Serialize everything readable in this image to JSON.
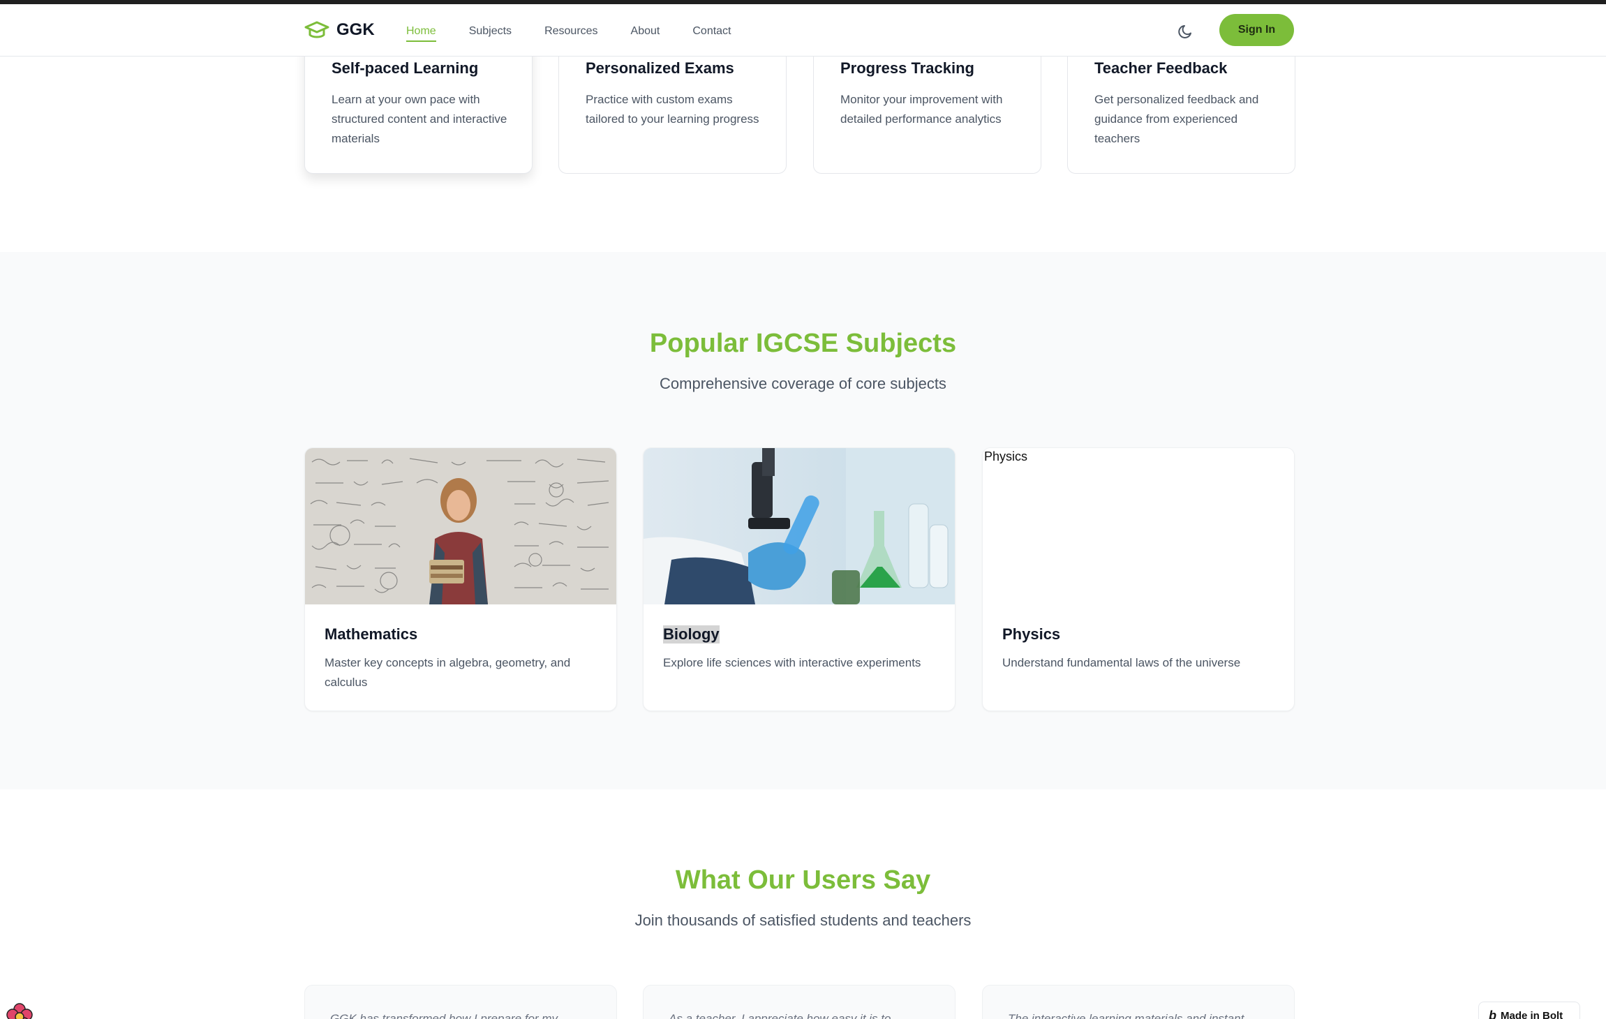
{
  "nav": {
    "brand": "GGK",
    "links": [
      {
        "label": "Home",
        "active": true
      },
      {
        "label": "Subjects",
        "active": false
      },
      {
        "label": "Resources",
        "active": false
      },
      {
        "label": "About",
        "active": false
      },
      {
        "label": "Contact",
        "active": false
      }
    ],
    "theme_icon": "moon-icon",
    "signin_label": "Sign In"
  },
  "features": [
    {
      "title": "Self-paced Learning",
      "desc": "Learn at your own pace with structured content and interactive materials"
    },
    {
      "title": "Personalized Exams",
      "desc": "Practice with custom exams tailored to your learning progress"
    },
    {
      "title": "Progress Tracking",
      "desc": "Monitor your improvement with detailed performance analytics"
    },
    {
      "title": "Teacher Feedback",
      "desc": "Get personalized feedback and guidance from experienced teachers"
    }
  ],
  "subjects": {
    "title": "Popular IGCSE Subjects",
    "subtitle": "Comprehensive coverage of core subjects",
    "items": [
      {
        "title": "Mathematics",
        "desc": "Master key concepts in algebra, geometry, and calculus"
      },
      {
        "title": "Biology",
        "desc": "Explore life sciences with interactive experiments"
      },
      {
        "title": "Physics",
        "desc": "Understand fundamental laws of the universe",
        "img_alt": "Physics"
      }
    ]
  },
  "testimonials": {
    "title": "What Our Users Say",
    "subtitle": "Join thousands of satisfied students and teachers",
    "items": [
      {
        "quote": "GGK has transformed how I prepare for my..."
      },
      {
        "quote": "As a teacher, I appreciate how easy it is to..."
      },
      {
        "quote": "The interactive learning materials and instant..."
      }
    ]
  },
  "badge": {
    "label": "Made in Bolt"
  },
  "colors": {
    "accent": "#7cbd3a",
    "section_bg": "#f9fafb",
    "text": "#111827",
    "muted": "#4b5563"
  }
}
